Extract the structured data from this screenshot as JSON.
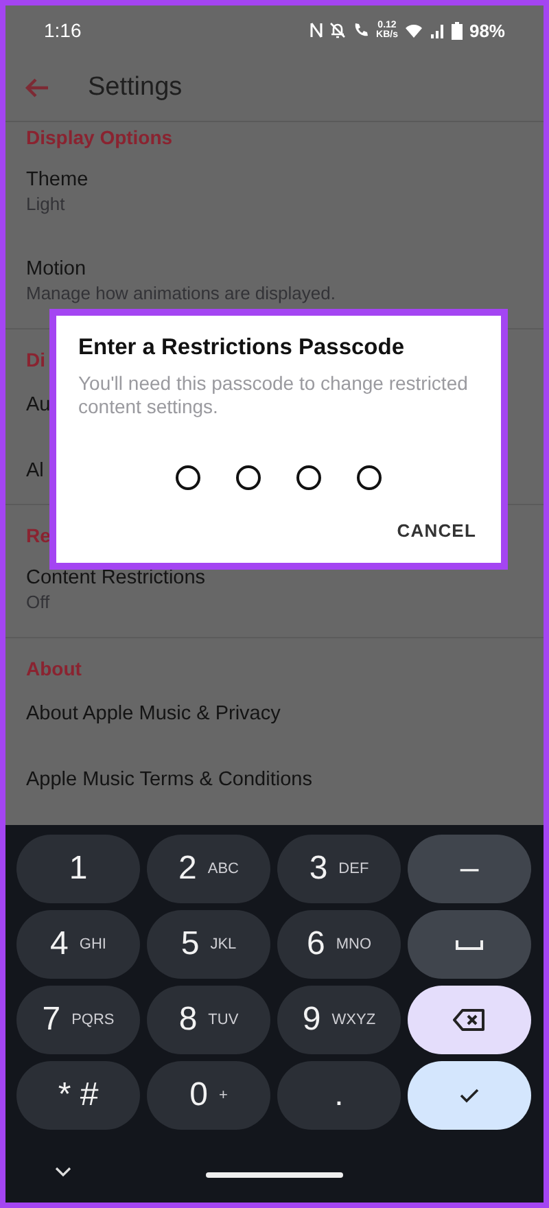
{
  "status_bar": {
    "time": "1:16",
    "net_speed_value": "0.12",
    "net_speed_unit": "KB/s",
    "battery": "98%"
  },
  "app_bar": {
    "title": "Settings"
  },
  "sections": [
    {
      "header": "Display Options",
      "items": [
        {
          "title": "Theme",
          "subtitle": "Light"
        },
        {
          "title": "Motion",
          "subtitle": "Manage how animations are displayed."
        }
      ]
    },
    {
      "header": "Di",
      "items": [
        {
          "title": "Au"
        },
        {
          "title": "Al"
        }
      ]
    },
    {
      "header": "Re",
      "items": [
        {
          "title": "Content Restrictions",
          "subtitle": "Off"
        }
      ]
    },
    {
      "header": "About",
      "items": [
        {
          "title": "About Apple Music & Privacy"
        },
        {
          "title": "Apple Music Terms & Conditions"
        }
      ]
    }
  ],
  "dialog": {
    "title": "Enter a Restrictions Passcode",
    "message": "You'll need this passcode to change restricted content settings.",
    "passcode_digits": [
      {
        "filled": false
      },
      {
        "filled": false
      },
      {
        "filled": false
      },
      {
        "filled": false
      }
    ],
    "button": "CANCEL"
  },
  "keypad": [
    {
      "kind": "digit",
      "label": "1"
    },
    {
      "kind": "digit",
      "label": "2",
      "letters": "ABC"
    },
    {
      "kind": "digit",
      "label": "3",
      "letters": "DEF"
    },
    {
      "kind": "symbol",
      "label": "–"
    },
    {
      "kind": "digit",
      "label": "4",
      "letters": "GHI"
    },
    {
      "kind": "digit",
      "label": "5",
      "letters": "JKL"
    },
    {
      "kind": "digit",
      "label": "6",
      "letters": "MNO"
    },
    {
      "kind": "space"
    },
    {
      "kind": "digit",
      "label": "7",
      "letters": "PQRS"
    },
    {
      "kind": "digit",
      "label": "8",
      "letters": "TUV"
    },
    {
      "kind": "digit",
      "label": "9",
      "letters": "WXYZ"
    },
    {
      "kind": "backspace"
    },
    {
      "kind": "digit",
      "label": "* #"
    },
    {
      "kind": "digit",
      "label": "0",
      "letters": "+"
    },
    {
      "kind": "digit",
      "label": "."
    },
    {
      "kind": "done"
    }
  ]
}
